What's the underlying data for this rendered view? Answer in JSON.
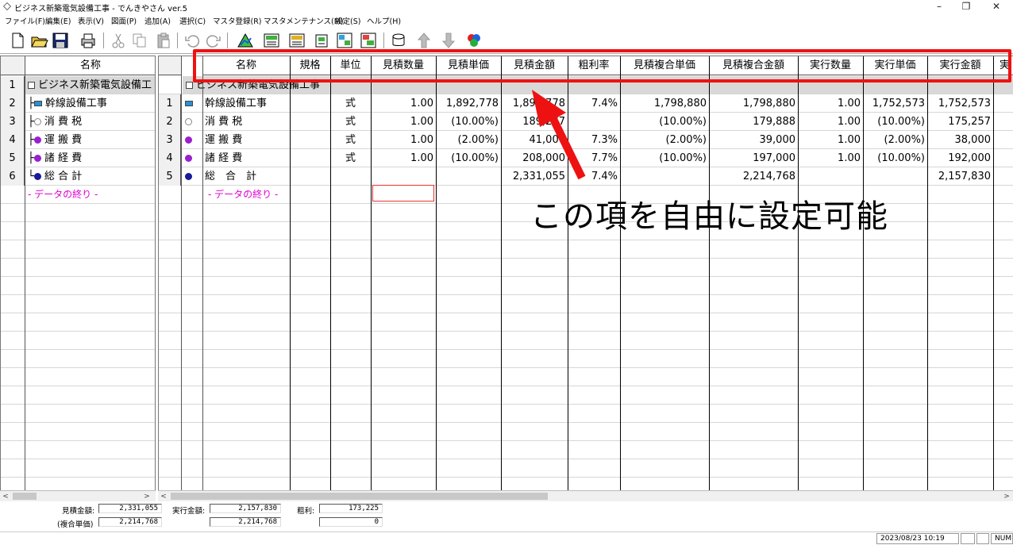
{
  "window": {
    "title": "ビジネス新築電気設備工事 - でんきやさん ver.5",
    "minimize": "–",
    "restore": "❐",
    "close": "✕"
  },
  "menu": [
    "ファイル(F)",
    "編集(E)",
    "表示(V)",
    "図面(P)",
    "追加(A)",
    "選択(C)",
    "マスタ登録(R)",
    "マスタメンテナンス(M)",
    "設定(S)",
    "ヘルプ(H)"
  ],
  "left_tree": {
    "header": "名称",
    "rows": [
      {
        "num": "1",
        "prefix": "",
        "label": "ビジネス新築電気設備工"
      },
      {
        "num": "2",
        "prefix": "├",
        "label": "幹線設備工事"
      },
      {
        "num": "3",
        "prefix": "├",
        "label": "消 費 税"
      },
      {
        "num": "4",
        "prefix": "├",
        "label": "運 搬 費"
      },
      {
        "num": "5",
        "prefix": "├",
        "label": "諸 経 費"
      },
      {
        "num": "6",
        "prefix": "└",
        "label": "総 合 計"
      }
    ],
    "end_marker": "- データの終り -"
  },
  "main_grid": {
    "headers": [
      "名称",
      "規格",
      "単位",
      "見積数量",
      "見積単価",
      "見積金額",
      "粗利率",
      "見積複合単価",
      "見積複合金額",
      "実行数量",
      "実行単価",
      "実行金額",
      "実"
    ],
    "group_row": "ビジネス新築電気設備工事",
    "rows": [
      {
        "num": "1",
        "name": "幹線設備工事",
        "spec": "",
        "unit": "式",
        "qty": "1.00",
        "price": "1,892,778",
        "amount": "1,892,778",
        "margin": "7.4%",
        "cprice": "1,798,880",
        "camount": "1,798,880",
        "eqty": "1.00",
        "eprice": "1,752,573",
        "eamount": "1,752,573"
      },
      {
        "num": "2",
        "name": "消 費 税",
        "spec": "",
        "unit": "式",
        "qty": "1.00",
        "price": "(10.00%)",
        "amount": "189,277",
        "margin": "",
        "cprice": "(10.00%)",
        "camount": "179,888",
        "eqty": "1.00",
        "eprice": "(10.00%)",
        "eamount": "175,257"
      },
      {
        "num": "3",
        "name": "運 搬 費",
        "spec": "",
        "unit": "式",
        "qty": "1.00",
        "price": "(2.00%)",
        "amount": "41,000",
        "margin": "7.3%",
        "cprice": "(2.00%)",
        "camount": "39,000",
        "eqty": "1.00",
        "eprice": "(2.00%)",
        "eamount": "38,000"
      },
      {
        "num": "4",
        "name": "諸 経 費",
        "spec": "",
        "unit": "式",
        "qty": "1.00",
        "price": "(10.00%)",
        "amount": "208,000",
        "margin": "7.7%",
        "cprice": "(10.00%)",
        "camount": "197,000",
        "eqty": "1.00",
        "eprice": "(10.00%)",
        "eamount": "192,000"
      },
      {
        "num": "5",
        "name": "総　合　計",
        "spec": "",
        "unit": "",
        "qty": "",
        "price": "",
        "amount": "2,331,055",
        "margin": "7.4%",
        "cprice": "",
        "camount": "2,214,768",
        "eqty": "",
        "eprice": "",
        "eamount": "2,157,830"
      }
    ],
    "end_marker": "- データの終り -"
  },
  "summary": {
    "est_label": "見積金額:",
    "est_value": "2,331,055",
    "composite_label": "(複合単価)",
    "composite_value": "2,214,768",
    "exec_label": "実行金額:",
    "exec_value": "2,157,830",
    "exec_composite_value": "2,214,768",
    "profit_label": "粗利:",
    "profit_value": "173,225",
    "profit_composite_value": "0"
  },
  "status": {
    "datetime": "2023/08/23 10:19",
    "num": "NUM"
  },
  "annotation": {
    "text": "この項を自由に設定可能",
    "color": "#ee1111"
  },
  "colors": {
    "icon_blue_rect": "#2a8fd8",
    "bullet_gray": "#b0b0b0",
    "bullet_purple": "#9b1fd0",
    "bullet_navy": "#1a1a9a",
    "end_marker": "#e000d0"
  }
}
